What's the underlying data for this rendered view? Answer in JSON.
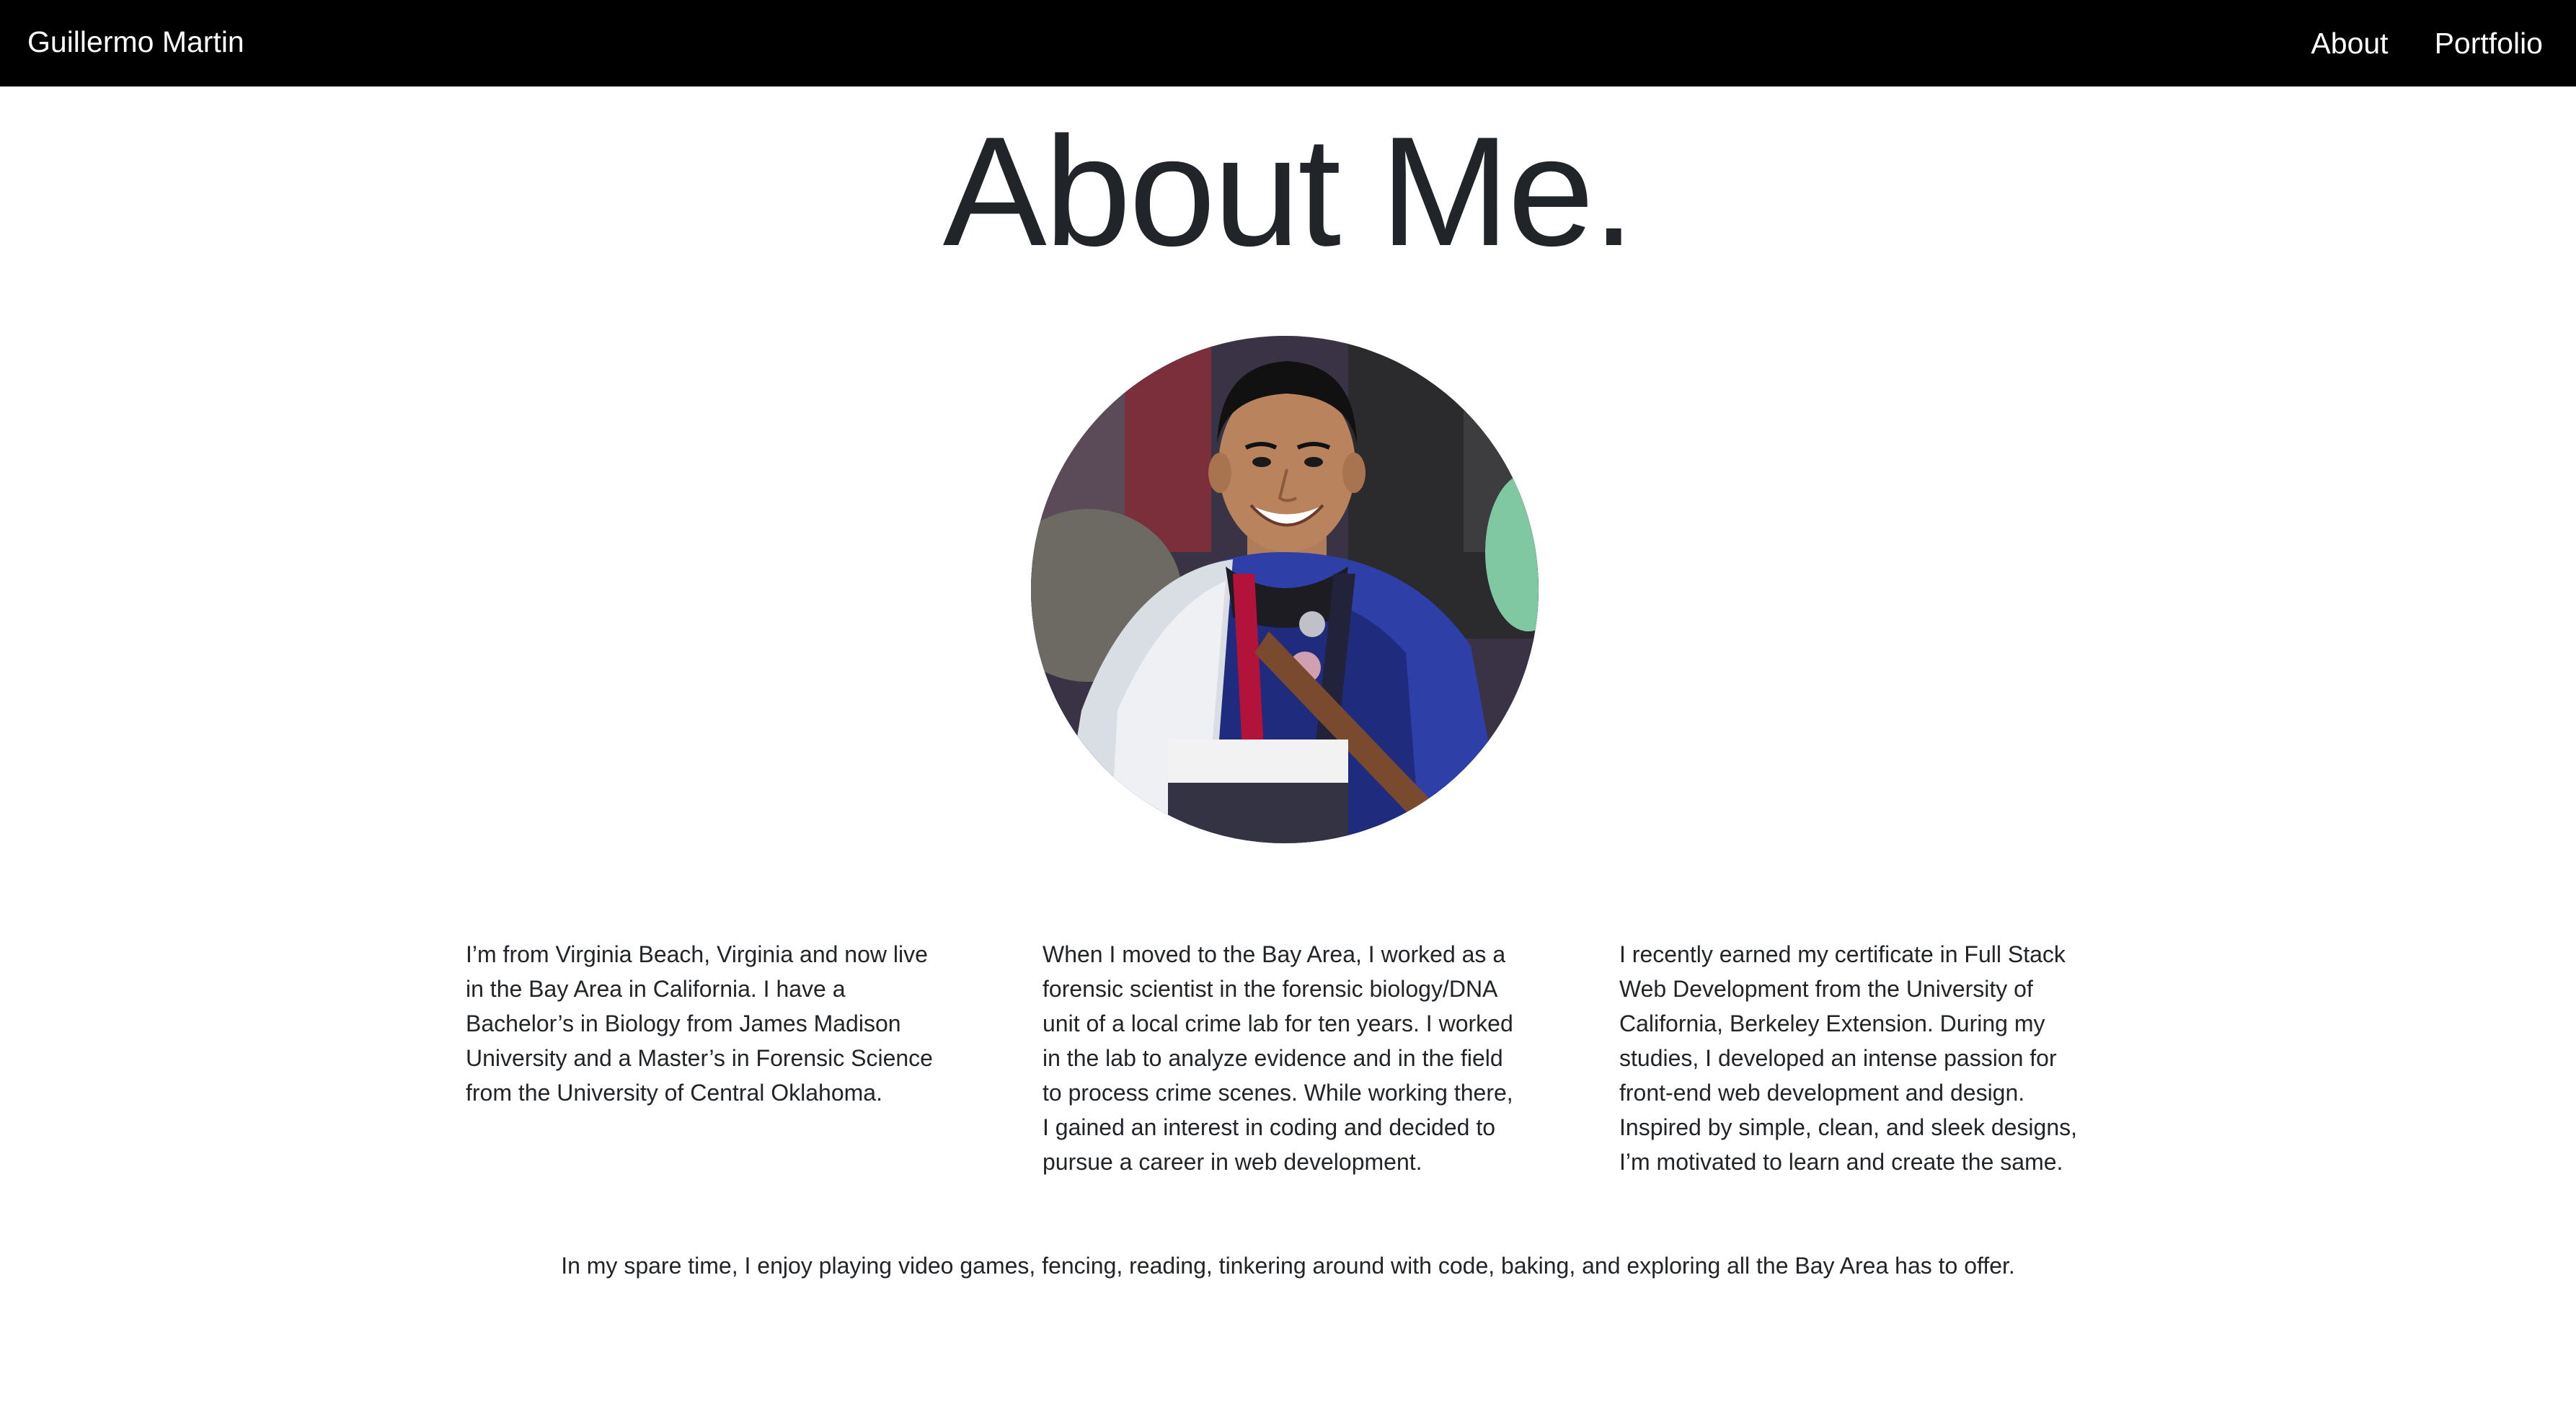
{
  "nav": {
    "brand": "Guillermo Martin",
    "links": [
      {
        "label": "About"
      },
      {
        "label": "Portfolio"
      }
    ]
  },
  "page": {
    "title": "About Me."
  },
  "bio": {
    "paragraphs": [
      "I’m from Virginia Beach, Virginia and now live in the Bay Area in California. I have a Bachelor’s in Biology from James Madison University and a Master’s in Forensic Science from the University of Central Oklahoma.",
      "When I moved to the Bay Area, I worked as a forensic scientist in the forensic biology/DNA unit of a local crime lab for ten years. I worked in the lab to analyze evidence and in the field to process crime scenes. While working there, I gained an interest in coding and decided to pursue a career in web development.",
      "I recently earned my certificate in Full Stack Web Development from the University of California, Berkeley Extension. During my studies, I developed an intense passion for front-end web development and design. Inspired by simple, clean, and sleek designs, I’m motivated to learn and create the same."
    ],
    "hobbies": "In my spare time, I enjoy playing video games, fencing, reading, tinkering around with code, baking, and exploring all the Bay Area has to offer."
  },
  "colors": {
    "navbar_bg": "#000000",
    "nav_text": "#ffffff",
    "body_text": "#212529",
    "page_bg": "#ffffff"
  }
}
